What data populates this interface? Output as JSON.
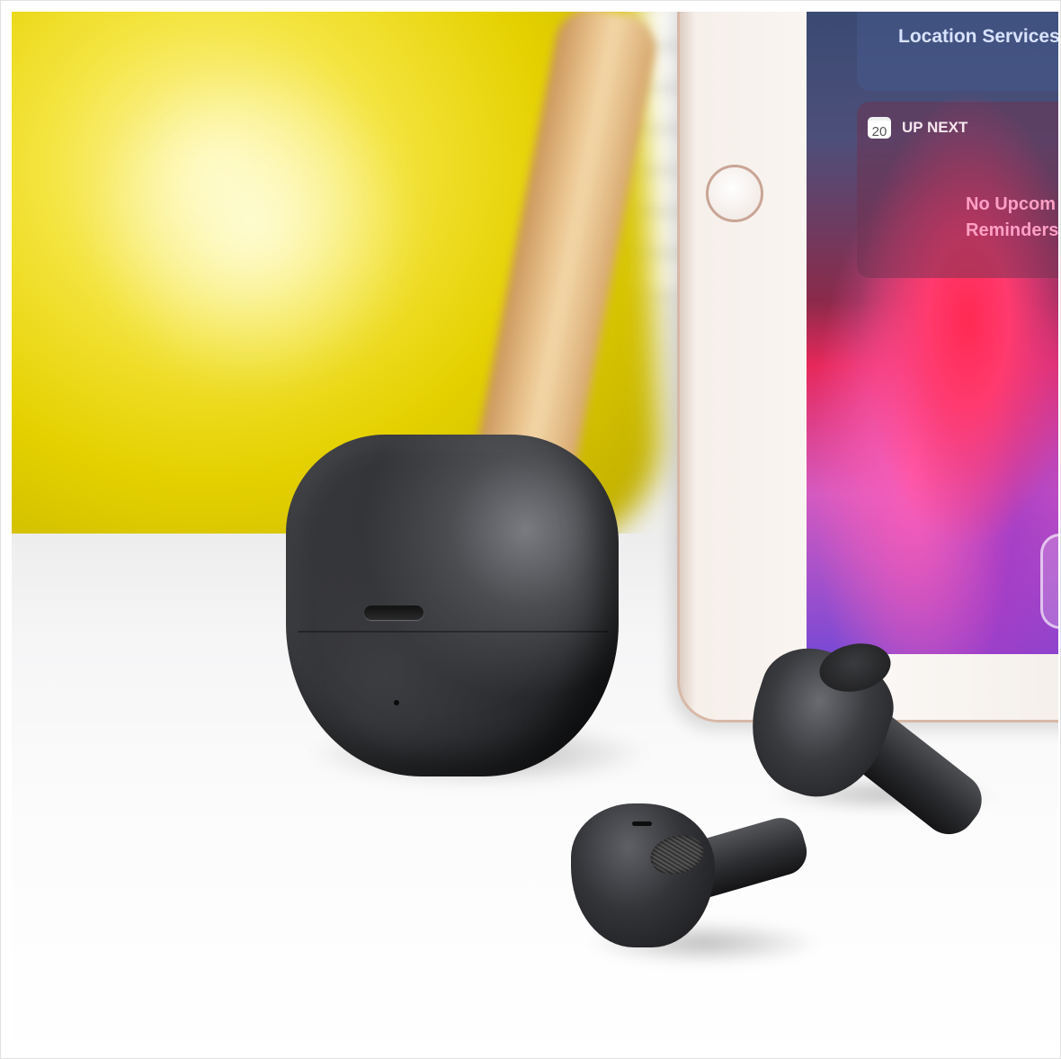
{
  "scene": {
    "description_colors": {
      "chair": "#e5d100",
      "case": "#2b2c2f",
      "screen_accent": "#ff2a52"
    }
  },
  "tablet_screen": {
    "location_widget": {
      "label": "Location Services"
    },
    "up_next_widget": {
      "calendar_day": "20",
      "label": "UP NEXT",
      "message_line1": "No Upcom",
      "message_line2": "Reminders"
    }
  }
}
